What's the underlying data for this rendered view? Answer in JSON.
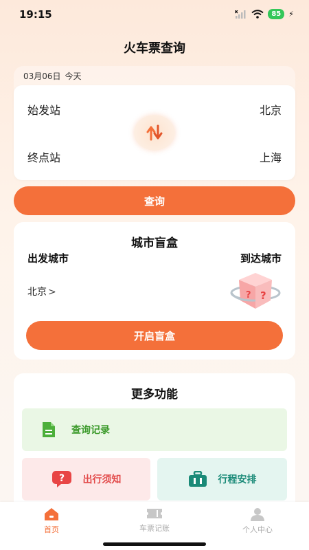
{
  "status_bar": {
    "time": "19:15",
    "battery": "85"
  },
  "header": {
    "title": "火车票查询"
  },
  "station_card": {
    "date": "03月06日",
    "day_label": "今天",
    "origin_label": "始发站",
    "origin_value": "北京",
    "destination_label": "终点站",
    "destination_value": "上海"
  },
  "query_button": "查询",
  "blind_box": {
    "title": "城市盲盒",
    "from_label": "出发城市",
    "to_label": "到达城市",
    "from_city": "北京",
    "open_button": "开启盲盒"
  },
  "more": {
    "title": "更多功能",
    "history": "查询记录",
    "notice": "出行须知",
    "plan": "行程安排"
  },
  "tabs": [
    {
      "label": "首页",
      "icon": "home-icon"
    },
    {
      "label": "车票记账",
      "icon": "ticket-icon"
    },
    {
      "label": "个人中心",
      "icon": "person-icon"
    }
  ],
  "colors": {
    "accent": "#f4703a",
    "green": "#3b9a2a",
    "red": "#e24a4a",
    "teal": "#1a8a78"
  }
}
